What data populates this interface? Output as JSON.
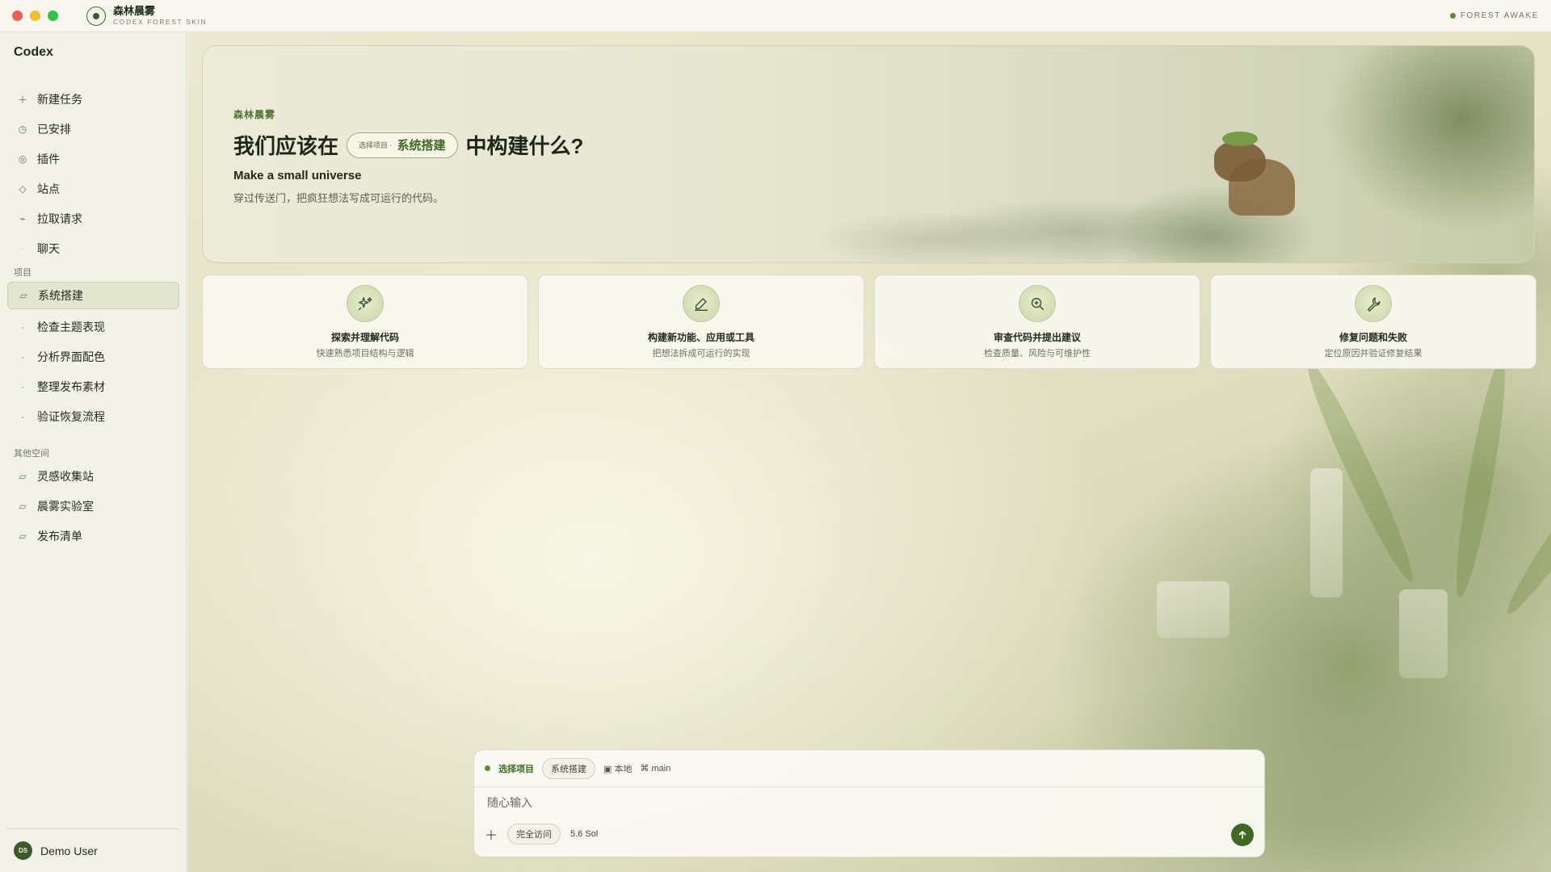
{
  "window": {
    "brand_title": "森林晨雾",
    "brand_subtitle": "CODEX FOREST SKIN",
    "status_text": "FOREST AWAKE"
  },
  "sidebar": {
    "app_name": "Codex",
    "nav": [
      {
        "label": "新建任务",
        "icon": "plus-icon"
      },
      {
        "label": "已安排",
        "icon": "clock-icon"
      },
      {
        "label": "插件",
        "icon": "plugin-icon"
      },
      {
        "label": "站点",
        "icon": "diamond-icon"
      },
      {
        "label": "拉取请求",
        "icon": "pull-request-icon"
      },
      {
        "label": "聊天",
        "icon": "chat-icon"
      }
    ],
    "projects_label": "项目",
    "projects": [
      {
        "label": "系统搭建",
        "icon": "folder-icon",
        "active": true
      },
      {
        "label": "检查主题表现",
        "icon": "dot-icon"
      },
      {
        "label": "分析界面配色",
        "icon": "dot-icon"
      },
      {
        "label": "整理发布素材",
        "icon": "dot-icon"
      },
      {
        "label": "验证恢复流程",
        "icon": "dot-icon"
      }
    ],
    "other_label": "其他空间",
    "other": [
      {
        "label": "灵感收集站",
        "icon": "folder-icon"
      },
      {
        "label": "晨雾实验室",
        "icon": "folder-icon"
      },
      {
        "label": "发布清单",
        "icon": "folder-icon"
      }
    ],
    "user": {
      "initials": "DS",
      "name": "Demo User"
    }
  },
  "hero": {
    "eyebrow": "森林晨雾",
    "title_before": "我们应该在",
    "pill_label": "选择项目 ·",
    "pill_value": "系统搭建",
    "title_after": "中构建什么?",
    "subtitle": "Make a small universe",
    "description": "穿过传送门，把疯狂想法写成可运行的代码。"
  },
  "cards": [
    {
      "title": "探索并理解代码",
      "desc": "快速熟悉项目结构与逻辑",
      "icon": "sparkle-icon"
    },
    {
      "title": "构建新功能、应用或工具",
      "desc": "把想法拆成可运行的实现",
      "icon": "pencil-icon"
    },
    {
      "title": "审查代码并提出建议",
      "desc": "检查质量、风险与可维护性",
      "icon": "search-icon"
    },
    {
      "title": "修复问题和失败",
      "desc": "定位原因并验证修复结果",
      "icon": "wrench-icon"
    }
  ],
  "composer": {
    "select_label": "选择项目",
    "project_chip": "系统搭建",
    "location": "▣ 本地",
    "branch": "⌘ main",
    "placeholder": "随心输入",
    "access_chip": "完全访问",
    "model": "5.6 Sol"
  },
  "colors": {
    "accent": "#3e6a26",
    "status_dot": "#5e8a3a",
    "sidebar_bg": "#f3f2e8",
    "active_bg": "#e2e6cf"
  }
}
